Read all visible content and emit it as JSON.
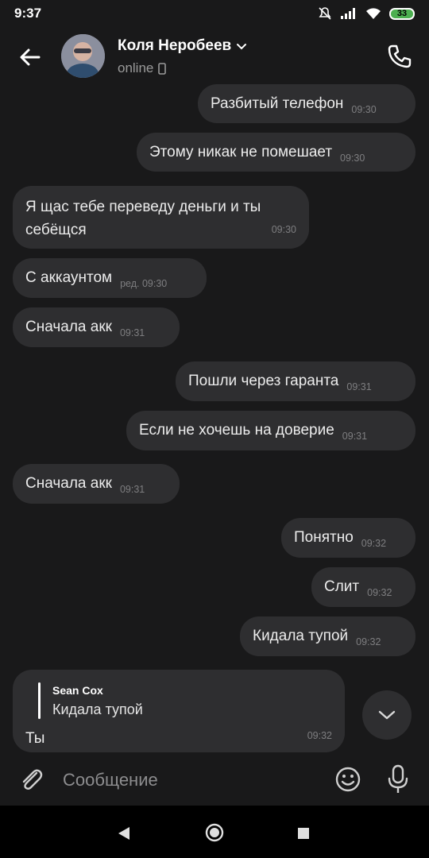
{
  "status_bar": {
    "time": "9:37",
    "battery": "33"
  },
  "header": {
    "contact_name": "Коля Неробеев",
    "status": "online"
  },
  "messages": [
    {
      "text": "Разбитый телефон",
      "time": "09:30",
      "direction": "out"
    },
    {
      "text": "Этому никак не помешает",
      "time": "09:30",
      "direction": "out"
    },
    {
      "text_line1": "Я щас тебе переведу деньги и ты",
      "text_line2": "себёщся",
      "time": "09:30",
      "direction": "in"
    },
    {
      "text": "С аккаунтом",
      "time": "ред. 09:30",
      "direction": "in"
    },
    {
      "text": "Сначала акк",
      "time": "09:31",
      "direction": "in"
    },
    {
      "text": "Пошли через гаранта",
      "time": "09:31",
      "direction": "out"
    },
    {
      "text": "Если не хочешь на доверие",
      "time": "09:31",
      "direction": "out"
    },
    {
      "text": "Сначала акк",
      "time": "09:31",
      "direction": "in"
    },
    {
      "text": "Понятно",
      "time": "09:32",
      "direction": "out"
    },
    {
      "text": "Слит",
      "time": "09:32",
      "direction": "out"
    },
    {
      "text": "Кидала тупой",
      "time": "09:32",
      "direction": "out"
    }
  ],
  "reply_message": {
    "quoted_author": "Sean Cox",
    "quoted_text": "Кидала тупой",
    "text": "Ты",
    "time": "09:32"
  },
  "composer": {
    "placeholder": "Сообщение"
  },
  "icons": {
    "back": "arrow-left-icon",
    "call": "phone-icon",
    "attach": "paperclip-icon",
    "emoji": "smile-icon",
    "mic": "microphone-icon",
    "scroll_down": "chevron-down-icon"
  },
  "colors": {
    "background": "#19191a",
    "bubble": "#2e2e30",
    "time_text": "#7e7e80"
  }
}
